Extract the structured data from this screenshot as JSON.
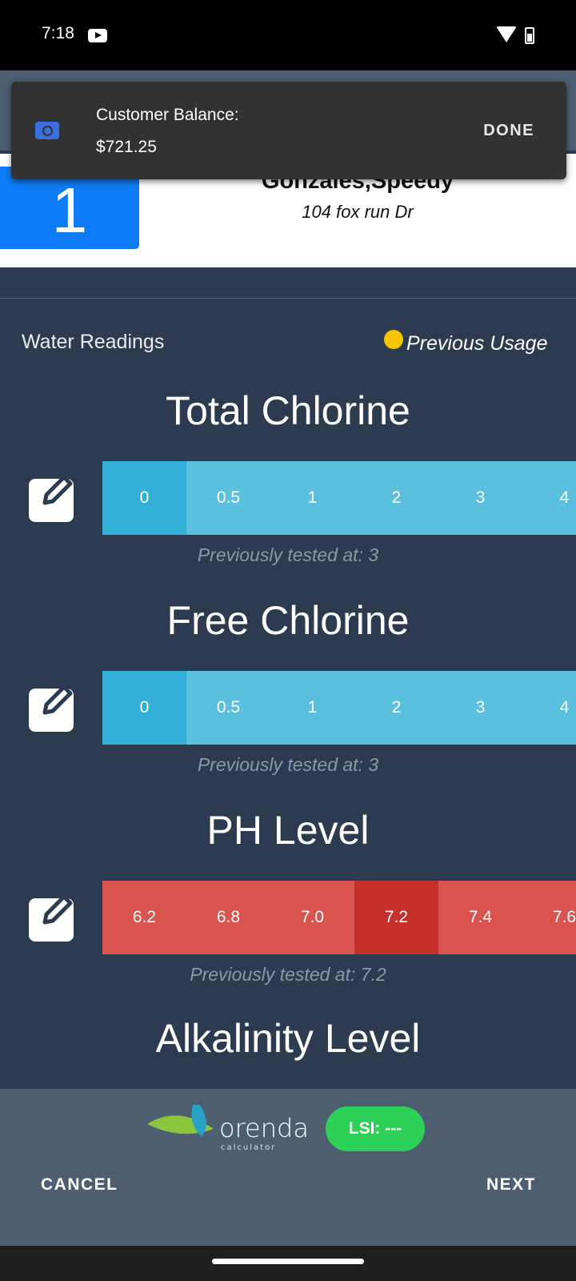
{
  "status": {
    "time": "7:18"
  },
  "customer": {
    "number": "1",
    "name": "Gonzales,Speedy",
    "address": "104 fox run Dr"
  },
  "toast": {
    "label": "Customer Balance:",
    "amount": "$721.25",
    "action": "DONE"
  },
  "section": {
    "title": "Water Readings",
    "previous_usage": "Previous Usage"
  },
  "readings": [
    {
      "title": "Total Chlorine",
      "values": [
        "0",
        "0.5",
        "1",
        "2",
        "3",
        "4"
      ],
      "selected_index": 0,
      "previous": "Previously tested at: 3"
    },
    {
      "title": "Free Chlorine",
      "values": [
        "0",
        "0.5",
        "1",
        "2",
        "3",
        "4"
      ],
      "selected_index": 0,
      "previous": "Previously tested at: 3"
    },
    {
      "title": "PH Level",
      "values": [
        "6.2",
        "6.8",
        "7.0",
        "7.2",
        "7.4",
        "7.6"
      ],
      "selected_index": 3,
      "previous": "Previously tested at: 7.2"
    },
    {
      "title": "Alkalinity Level"
    }
  ],
  "colors": {
    "chlorine": "#5bbfde",
    "chlorine_selected": "#31afd6",
    "ph": "#d9534f",
    "ph_selected": "#c62f2b",
    "lsi": "#2ed158"
  },
  "footer": {
    "logo": "orenda calculator",
    "lsi": "LSI: ---",
    "cancel": "CANCEL",
    "next": "NEXT"
  }
}
